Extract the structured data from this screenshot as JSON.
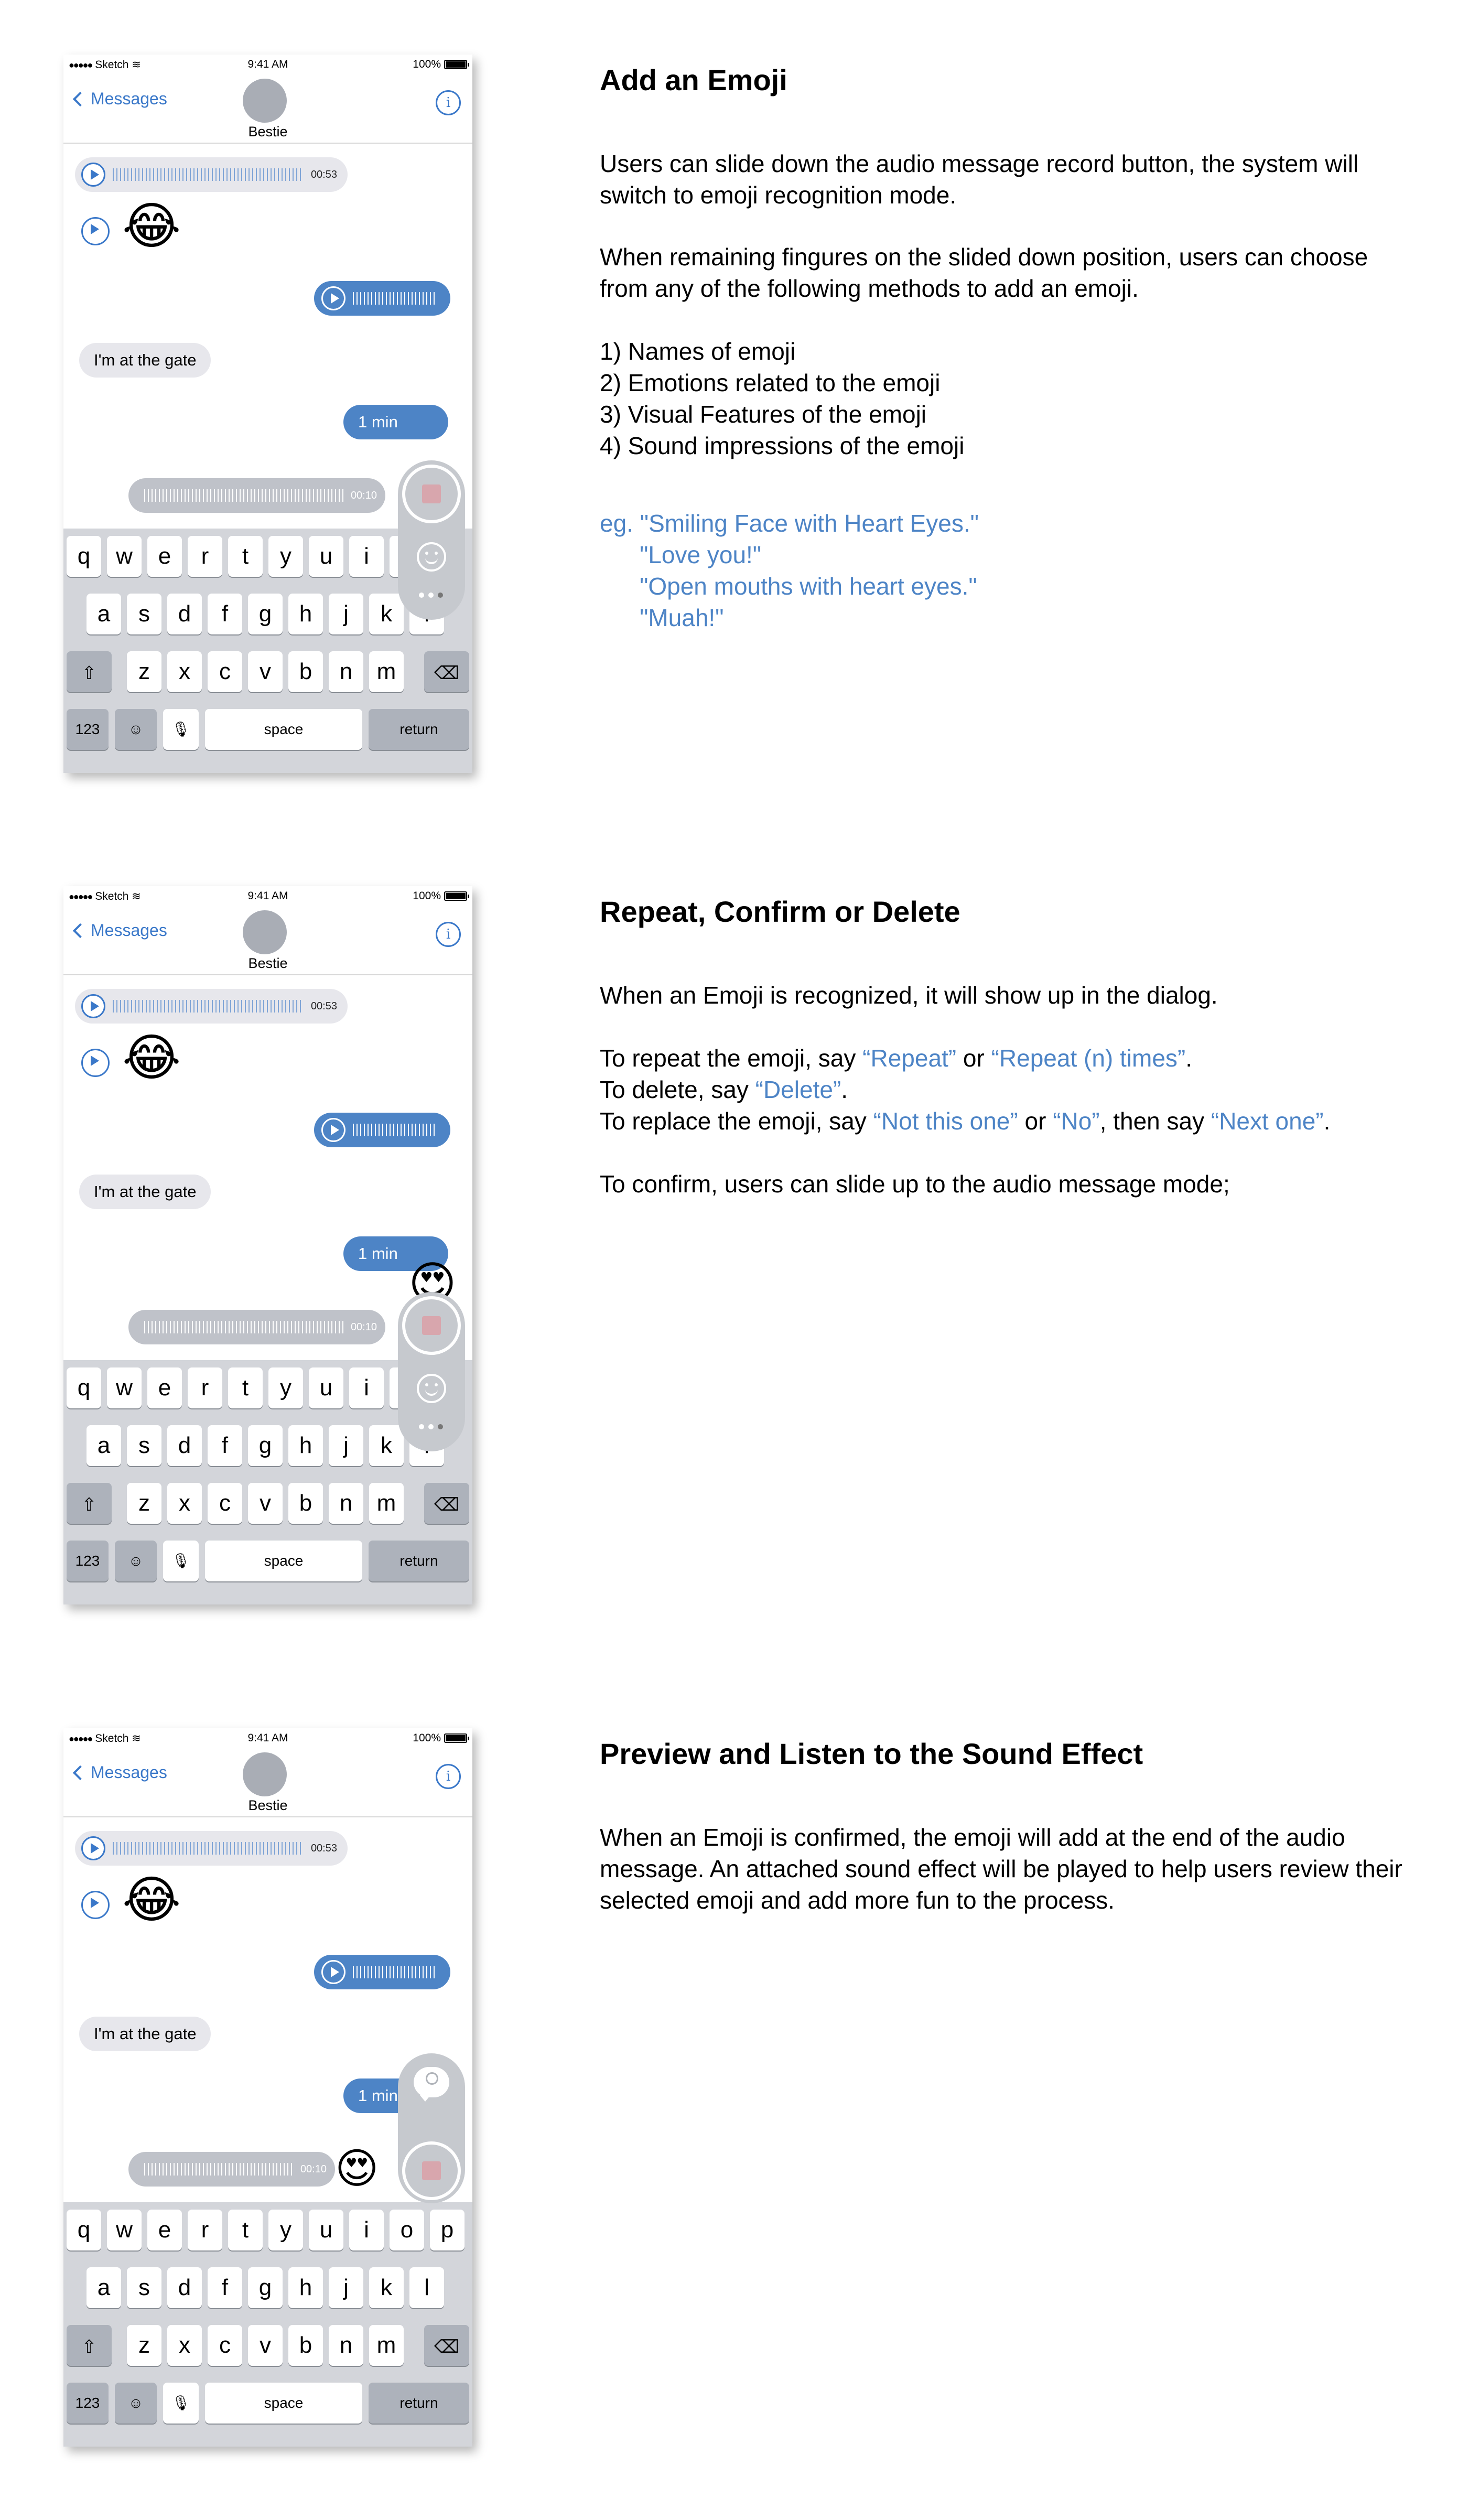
{
  "phone": {
    "status": {
      "carrier": "Sketch",
      "time": "9:41 AM",
      "battery": "100%"
    },
    "nav": {
      "back": "Messages",
      "contact": "Bestie"
    },
    "audio_duration": "00:53",
    "text_message": "I'm at the gate",
    "sent_text": "1 min",
    "record_duration": "00:10",
    "keys_row1": [
      "q",
      "w",
      "e",
      "r",
      "t",
      "y",
      "u",
      "i",
      "o",
      "p"
    ],
    "keys_row2": [
      "a",
      "s",
      "d",
      "f",
      "g",
      "h",
      "j",
      "k",
      "l"
    ],
    "keys_row3": [
      "z",
      "x",
      "c",
      "v",
      "b",
      "n",
      "m"
    ],
    "key_123": "123",
    "key_space": "space",
    "key_return": "return",
    "emoji_laugh": "😂",
    "emoji_heart_eyes": "😍"
  },
  "sections": [
    {
      "title": "Add an Emoji",
      "p1": "Users can slide down the audio message record button, the system will switch to emoji recognition mode.",
      "p2": "When remaining fingures on the slided down position, users can choose from any of the following methods to add an emoji.",
      "list": [
        "1) Names of emoji",
        "2) Emotions related to the emoji",
        "3) Visual Features of the emoji",
        "4) Sound impressions of the emoji"
      ],
      "example_prefix": "eg.",
      "examples": [
        "\"Smiling Face with Heart Eyes.\"",
        "\"Love you!\"",
        "\"Open mouths with heart eyes.\"",
        "\"Muah!\""
      ]
    },
    {
      "title": "Repeat, Confirm or Delete",
      "p1": "When an Emoji is recognized, it will show up in the dialog.",
      "repeat_pre": "To repeat the emoji, say ",
      "repeat_q1": "“Repeat”",
      "repeat_mid": " or ",
      "repeat_q2": "“Repeat (n) times”",
      "repeat_end": ".",
      "delete_pre": "To delete, say ",
      "delete_q": "“Delete”",
      "delete_end": ".",
      "replace_pre": "To replace the emoji, say ",
      "replace_q1": "“Not this one”",
      "replace_mid1": " or ",
      "replace_q2": "“No”",
      "replace_mid2": ", then say ",
      "replace_q3": "“Next one”",
      "replace_end": ".",
      "confirm": "To confirm, users can slide up to the audio message mode;"
    },
    {
      "title": "Preview and Listen to the Sound Effect",
      "p1": "When an Emoji is confirmed, the emoji will add at the end of the audio message. An attached sound effect will be played to help users review their selected emoji and add more fun to the process."
    }
  ],
  "colors": {
    "accent": "#4d84c6",
    "link": "#3a78c9",
    "bubble_grey": "#e7e7ec",
    "keyboard": "#d3d5da"
  }
}
